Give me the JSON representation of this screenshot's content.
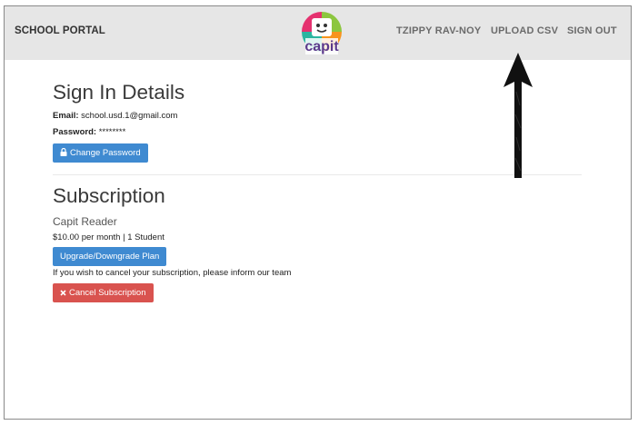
{
  "nav": {
    "brand": "SCHOOL PORTAL",
    "logo_text": "capit",
    "links": [
      "TZIPPY RAV-NOY",
      "UPLOAD CSV",
      "SIGN OUT"
    ]
  },
  "sign_in": {
    "heading": "Sign In Details",
    "email_label": "Email:",
    "email_value": "school.usd.1@gmail.com",
    "password_label": "Password:",
    "password_value": "********",
    "change_password_label": "Change Password"
  },
  "subscription": {
    "heading": "Subscription",
    "plan_name": "Capit Reader",
    "price_line": "$10.00 per month | 1 Student",
    "upgrade_label": "Upgrade/Downgrade Plan",
    "cancel_note": "If you wish to cancel your subscription, please inform our team",
    "cancel_label": "Cancel Subscription"
  },
  "colors": {
    "navbar_bg": "#e6e6e6",
    "primary_button": "#3f8ad1",
    "danger_button": "#d9534f",
    "logo_text": "#5b3a8c"
  },
  "icons": {
    "change_password": "lock-icon",
    "cancel": "close-icon",
    "annotation": "arrow-up-icon"
  }
}
